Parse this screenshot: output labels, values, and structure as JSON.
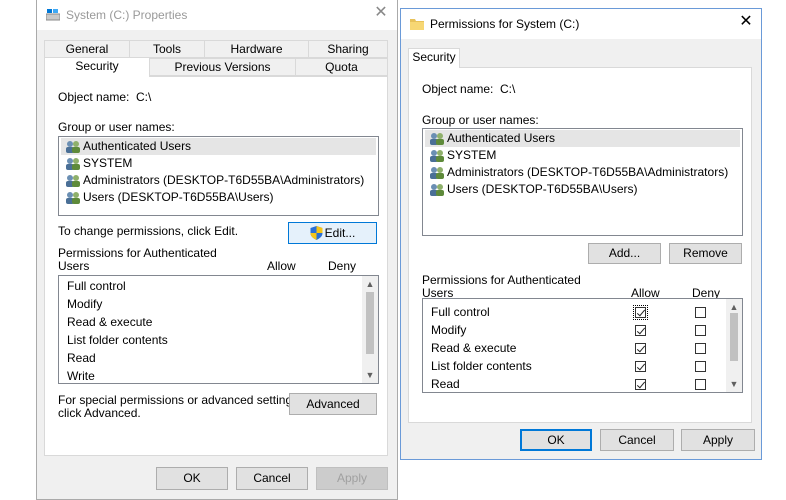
{
  "props_window": {
    "title": "System (C:) Properties",
    "tabs_row1": [
      "General",
      "Tools",
      "Hardware",
      "Sharing"
    ],
    "tabs_row2": [
      "Security",
      "Previous Versions",
      "Quota"
    ],
    "object_name_label": "Object name:",
    "object_name_value": "C:\\",
    "group_label": "Group or user names:",
    "users": [
      "Authenticated Users",
      "SYSTEM",
      "Administrators (DESKTOP-T6D55BA\\Administrators)",
      "Users (DESKTOP-T6D55BA\\Users)"
    ],
    "change_hint": "To change permissions, click Edit.",
    "edit_label": "Edit...",
    "perm_header_line1": "Permissions for Authenticated",
    "perm_header_line2": "Users",
    "allow_label": "Allow",
    "deny_label": "Deny",
    "permissions": [
      "Full control",
      "Modify",
      "Read & execute",
      "List folder contents",
      "Read",
      "Write"
    ],
    "special_line1": "For special permissions or advanced settings,",
    "special_line2": "click Advanced.",
    "advanced_label": "Advanced",
    "ok_label": "OK",
    "cancel_label": "Cancel",
    "apply_label": "Apply"
  },
  "perm_window": {
    "title": "Permissions for System (C:)",
    "tab_label": "Security",
    "object_name_label": "Object name:",
    "object_name_value": "C:\\",
    "group_label": "Group or user names:",
    "users": [
      "Authenticated Users",
      "SYSTEM",
      "Administrators (DESKTOP-T6D55BA\\Administrators)",
      "Users (DESKTOP-T6D55BA\\Users)"
    ],
    "add_label": "Add...",
    "remove_label": "Remove",
    "perm_header_line1": "Permissions for Authenticated",
    "perm_header_line2": "Users",
    "allow_label": "Allow",
    "deny_label": "Deny",
    "permissions": [
      {
        "name": "Full control",
        "allow": true,
        "deny": false
      },
      {
        "name": "Modify",
        "allow": true,
        "deny": false
      },
      {
        "name": "Read & execute",
        "allow": true,
        "deny": false
      },
      {
        "name": "List folder contents",
        "allow": true,
        "deny": false
      },
      {
        "name": "Read",
        "allow": true,
        "deny": false
      }
    ],
    "ok_label": "OK",
    "cancel_label": "Cancel",
    "apply_label": "Apply"
  },
  "close_glyph": "✕",
  "colors": {
    "accent": "#0078d7",
    "window_bg": "#f0f0f0",
    "selection": "#e5e5e5"
  }
}
